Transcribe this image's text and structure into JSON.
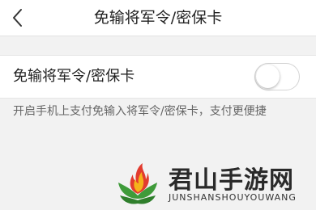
{
  "nav": {
    "title": "免输将军令/密保卡",
    "back_icon": "chevron-left-icon"
  },
  "setting": {
    "label": "免输将军令/密保卡",
    "toggle_on": false
  },
  "hint": "开启手机上支付免输入将军令/密保卡，支付更便捷",
  "watermark": {
    "title": "君山手游网",
    "subtitle": "JUNSHANSHOUYOUWANG",
    "logo_icon": "flame-leaf-logo",
    "colors": {
      "flame_red": "#e23b2e",
      "flame_yellow": "#f5b21a",
      "leaf_green": "#3f9b3a"
    }
  }
}
